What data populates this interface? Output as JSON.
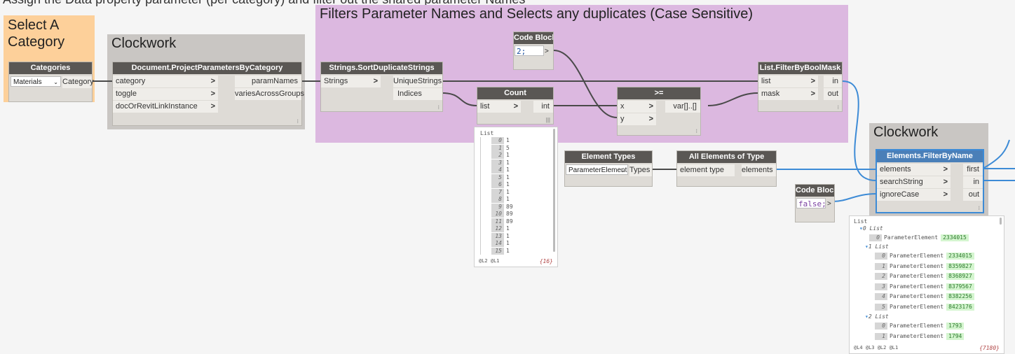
{
  "canvas_bg": "#f5f5f5",
  "top_note": "Assign the Data property parameter (per category) and filter out the shared parameter Names",
  "groups": {
    "select_category": {
      "title": "Select A\nCategory",
      "color": "#fdd09a"
    },
    "clockwork1": {
      "title": "Clockwork",
      "color": "#c9c6c3"
    },
    "filters": {
      "title": "Filters Parameter Names and Selects any duplicates (Case Sensitive)",
      "color": "#dcb8e0"
    },
    "clockwork2": {
      "title": "Clockwork",
      "color": "#c9c6c3"
    }
  },
  "nodes": {
    "categories": {
      "title": "Categories",
      "dropdown": "Materials",
      "output": "Category"
    },
    "project_params": {
      "title": "Document.ProjectParametersByCategory",
      "inputs": [
        "category",
        "toggle",
        "docOrRevitLinkInstance"
      ],
      "outputs": [
        "paramNames",
        "variesAcrossGroups"
      ]
    },
    "sort_dup": {
      "title": "Strings.SortDuplicateStrings",
      "inputs": [
        "Strings"
      ],
      "outputs": [
        "UniqueStrings",
        "Indices"
      ]
    },
    "code_block1": {
      "title": "Code Block",
      "code": "2;"
    },
    "count": {
      "title": "Count",
      "inputs": [
        "list"
      ],
      "outputs": [
        "int"
      ]
    },
    "gte": {
      "title": ">=",
      "inputs": [
        "x",
        "y"
      ],
      "outputs": [
        "var[]..[]"
      ]
    },
    "filter_mask": {
      "title": "List.FilterByBoolMask",
      "inputs": [
        "list",
        "mask"
      ],
      "outputs": [
        "in",
        "out"
      ]
    },
    "element_types": {
      "title": "Element Types",
      "dropdown": "ParameterElement",
      "output": "Types"
    },
    "all_elements": {
      "title": "All Elements of Type",
      "inputs": [
        "element type"
      ],
      "outputs": [
        "elements"
      ]
    },
    "code_block2": {
      "title": "Code Block",
      "code": "false;"
    },
    "filter_name": {
      "title": "Elements.FilterByName",
      "inputs": [
        "elements",
        "searchString",
        "ignoreCase"
      ],
      "outputs": [
        "first",
        "in",
        "out"
      ]
    }
  },
  "preview_count": {
    "header": "List",
    "rows": [
      [
        "0",
        "1"
      ],
      [
        "1",
        "5"
      ],
      [
        "2",
        "1"
      ],
      [
        "3",
        "1"
      ],
      [
        "4",
        "1"
      ],
      [
        "5",
        "1"
      ],
      [
        "6",
        "1"
      ],
      [
        "7",
        "1"
      ],
      [
        "8",
        "1"
      ],
      [
        "9",
        "89"
      ],
      [
        "10",
        "89"
      ],
      [
        "11",
        "89"
      ],
      [
        "12",
        "1"
      ],
      [
        "13",
        "1"
      ],
      [
        "14",
        "1"
      ],
      [
        "15",
        "1"
      ]
    ],
    "levels": "@L2 @L1",
    "count": "{16}"
  },
  "preview_filter": {
    "header": "List",
    "sub0": "0 List",
    "row0": [
      "0",
      "ParameterElement",
      "2334015"
    ],
    "sub1": "1 List",
    "rows1": [
      [
        "0",
        "ParameterElement",
        "2334015"
      ],
      [
        "1",
        "ParameterElement",
        "8359827"
      ],
      [
        "2",
        "ParameterElement",
        "8368927"
      ],
      [
        "3",
        "ParameterElement",
        "8379567"
      ],
      [
        "4",
        "ParameterElement",
        "8382256"
      ],
      [
        "5",
        "ParameterElement",
        "8423176"
      ]
    ],
    "sub2": "2 List",
    "rows2": [
      [
        "0",
        "ParameterElement",
        "1793"
      ],
      [
        "1",
        "ParameterElement",
        "1794"
      ]
    ],
    "levels": "@L4 @L3 @L2 @L1",
    "count": "{7180}"
  },
  "colors": {
    "wire": "#4a4a4a",
    "wire_selected": "#3d8bd6",
    "node_header": "#5a5754",
    "node_body": "#dedbd6"
  }
}
